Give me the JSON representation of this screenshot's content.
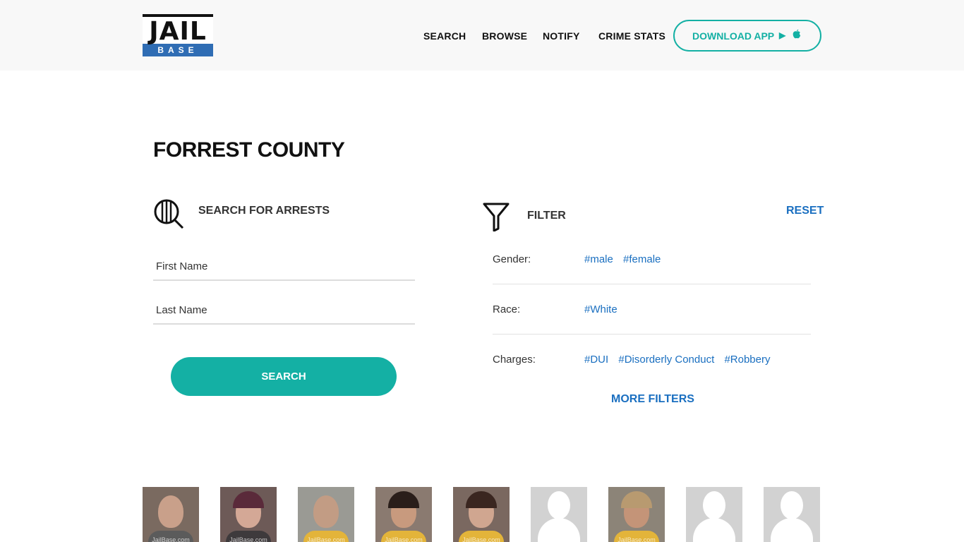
{
  "header": {
    "logo": {
      "line1": "JAIL",
      "line2": "BASE"
    },
    "nav": {
      "search": "SEARCH",
      "browse": "BROWSE",
      "notify": "NOTIFY",
      "crime_stats": "CRIME STATS"
    },
    "download": {
      "label": "DOWNLOAD APP",
      "icons": [
        "play-store-icon",
        "apple-icon"
      ]
    }
  },
  "page": {
    "title": "FORREST COUNTY"
  },
  "search": {
    "heading": "SEARCH FOR ARRESTS",
    "first_name_placeholder": "First Name",
    "last_name_placeholder": "Last Name",
    "button": "SEARCH"
  },
  "filter": {
    "heading": "FILTER",
    "reset": "RESET",
    "rows": [
      {
        "label": "Gender:",
        "tags": [
          "#male",
          "#female"
        ]
      },
      {
        "label": "Race:",
        "tags": [
          "#White"
        ]
      },
      {
        "label": "Charges:",
        "tags": [
          "#DUI",
          "#Disorderly Conduct",
          "#Robbery"
        ]
      }
    ],
    "more": "MORE FILTERS"
  },
  "mugshots": [
    {
      "type": "photo",
      "watermark": "JailBase.com"
    },
    {
      "type": "photo",
      "watermark": "JailBase.com"
    },
    {
      "type": "photo",
      "watermark": "JailBase.com"
    },
    {
      "type": "photo",
      "watermark": "JailBase.com"
    },
    {
      "type": "photo",
      "watermark": "JailBase.com"
    },
    {
      "type": "placeholder"
    },
    {
      "type": "photo",
      "watermark": "JailBase.com"
    },
    {
      "type": "placeholder"
    },
    {
      "type": "placeholder"
    }
  ],
  "colors": {
    "accent": "#14b0a4",
    "link": "#1a6fc0",
    "logo_blue": "#2f6db4"
  }
}
